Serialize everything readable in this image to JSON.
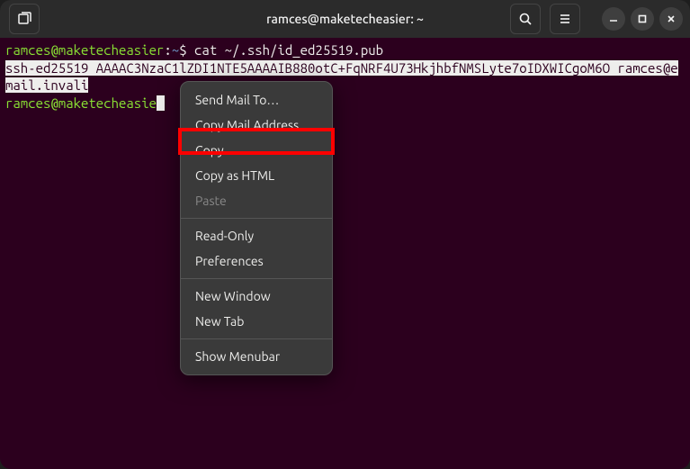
{
  "window": {
    "title": "ramces@maketecheasier: ~"
  },
  "terminal": {
    "prompt1": {
      "user_host": "ramces@maketecheasier",
      "sep": ":",
      "path": "~",
      "symbol": "$",
      "command": "cat ~/.ssh/id_ed25519.pub"
    },
    "output_selected": "ssh-ed25519 AAAAC3NzaC1lZDI1NTE5AAAAIB880otC+FqNRF4U73HkjhbfNMSLyte7oIDXWICgoM6O ramces@email.invali",
    "prompt2": {
      "user_host": "ramces@maketecheasie",
      "truncated": true
    }
  },
  "context_menu": {
    "items": [
      {
        "label": "Send Mail To…",
        "enabled": true
      },
      {
        "label": "Copy Mail Address",
        "enabled": true
      },
      {
        "label": "Copy",
        "enabled": true,
        "highlighted": true
      },
      {
        "label": "Copy as HTML",
        "enabled": true
      },
      {
        "label": "Paste",
        "enabled": false
      },
      {
        "sep": true
      },
      {
        "label": "Read-Only",
        "enabled": true
      },
      {
        "label": "Preferences",
        "enabled": true
      },
      {
        "sep": true
      },
      {
        "label": "New Window",
        "enabled": true
      },
      {
        "label": "New Tab",
        "enabled": true
      },
      {
        "sep": true
      },
      {
        "label": "Show Menubar",
        "enabled": true
      }
    ]
  },
  "icons": {
    "new_tab": "new-tab-icon",
    "search": "search-icon",
    "menu": "hamburger-icon",
    "minimize": "minimize-icon",
    "maximize": "maximize-icon",
    "close": "close-icon"
  }
}
